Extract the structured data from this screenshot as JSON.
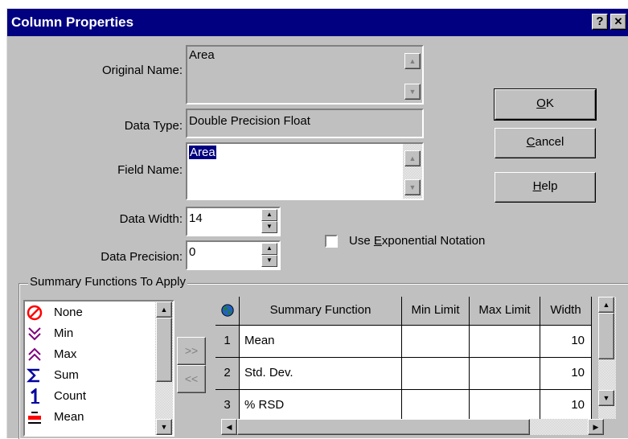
{
  "window": {
    "title": "Column Properties",
    "help_btn": "?",
    "close_btn": "✕"
  },
  "form": {
    "original_name_label": "Original Name:",
    "original_name_value": "Area",
    "data_type_label": "Data Type:",
    "data_type_value": "Double Precision Float",
    "field_name_label": "Field Name:",
    "field_name_value": "Area",
    "data_width_label": "Data Width:",
    "data_width_value": "14",
    "data_precision_label": "Data Precision:",
    "data_precision_value": "0",
    "exp_notation_pre": "Use ",
    "exp_notation_u": "E",
    "exp_notation_post": "xponential Notation",
    "exp_notation_checked": false
  },
  "buttons": {
    "ok_u": "O",
    "ok_rest": "K",
    "cancel_u": "C",
    "cancel_rest": "ancel",
    "help_u": "H",
    "help_rest": "elp"
  },
  "summary": {
    "group_label": "Summary Functions To Apply",
    "functions": [
      {
        "label": "None",
        "icon": "no-symbol-icon"
      },
      {
        "label": "Min",
        "icon": "double-chevron-down-icon"
      },
      {
        "label": "Max",
        "icon": "double-chevron-up-icon"
      },
      {
        "label": "Sum",
        "icon": "sigma-icon"
      },
      {
        "label": "Count",
        "icon": "number-one-icon"
      },
      {
        "label": "Mean",
        "icon": "mean-bar-icon"
      }
    ],
    "add_btn": ">>",
    "remove_btn": "<<",
    "grid_headers": [
      "Summary Function",
      "Min Limit",
      "Max Limit",
      "Width"
    ],
    "grid_rows": [
      {
        "num": "1",
        "function": "Mean",
        "min": "",
        "max": "",
        "width": "10"
      },
      {
        "num": "2",
        "function": "Std. Dev.",
        "min": "",
        "max": "",
        "width": "10"
      },
      {
        "num": "3",
        "function": "% RSD",
        "min": "",
        "max": "",
        "width": "10"
      }
    ]
  },
  "colors": {
    "titlebar": "#000080",
    "face": "#c0c0c0",
    "selection": "#000080"
  }
}
